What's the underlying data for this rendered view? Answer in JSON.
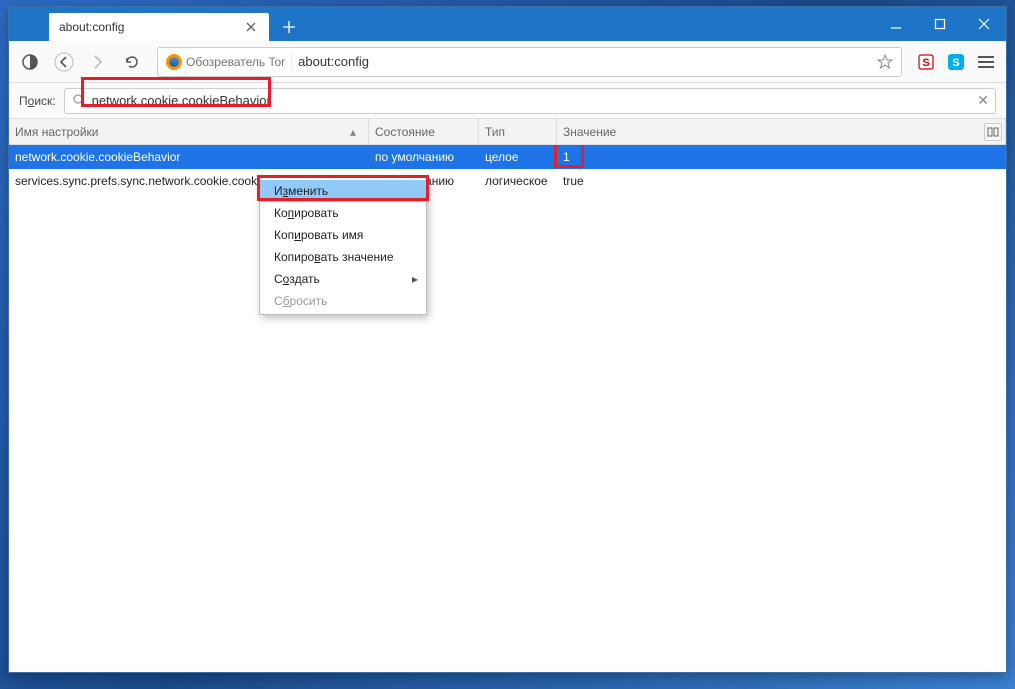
{
  "window": {
    "tab_title": "about:config",
    "identity_label": "Обозреватель Tor",
    "url": "about:config"
  },
  "search": {
    "label_pre": "П",
    "label_under": "о",
    "label_post": "иск:",
    "value": "network.cookie.cookieBehavior"
  },
  "columns": {
    "name": "Имя настройки",
    "state": "Состояние",
    "type": "Тип",
    "value": "Значение"
  },
  "rows": [
    {
      "name": "network.cookie.cookieBehavior",
      "state": "по умолчанию",
      "type": "целое",
      "value": "1",
      "selected": true
    },
    {
      "name": "services.sync.prefs.sync.network.cookie.cookieBehavior",
      "state": "по умолчанию",
      "type": "логическое",
      "value": "true",
      "selected": false
    }
  ],
  "context_menu": {
    "modify": "Изменить",
    "copy": "Копировать",
    "copy_name": "Копировать имя",
    "copy_value": "Копировать значение",
    "create": "Создать",
    "reset": "Сбросить"
  }
}
